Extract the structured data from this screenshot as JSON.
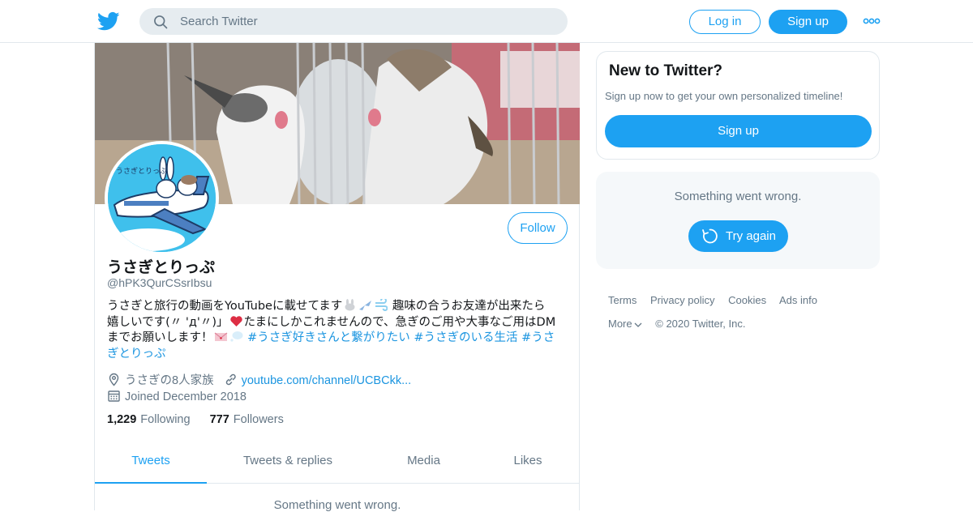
{
  "header": {
    "logo": "twitter-bird-icon",
    "search_placeholder": "Search Twitter",
    "login_label": "Log in",
    "signup_label": "Sign up",
    "more_icon": "more-dots-icon",
    "accent": "#1da1f2"
  },
  "profile": {
    "display_name": "うさぎとりっぷ",
    "handle": "@hPK3QurCSsrIbsu",
    "follow_label": "Follow",
    "bio_line1": "うさぎと旅行の動画をYouTubeに載せてます",
    "bio_line1b": "趣味の合うお友達が出来たら",
    "bio_line2a": "嬉しいです(〃 'д'〃)」",
    "bio_line2b": "たまにしかこれませんので、急ぎのご用や大事なご用はDM",
    "bio_line3": "までお願いします！",
    "bio_tag1": "#うさぎ好きさんと繋がりたい",
    "bio_tag2": "#うさぎのいる生活",
    "bio_tag3": "#うさ",
    "bio_tag3b": "ぎとりっぷ",
    "location": "うさぎの8人家族",
    "url": "youtube.com/channel/UCBCkk...",
    "joined": "Joined December 2018",
    "following_count": "1,229",
    "following_label": "Following",
    "followers_count": "777",
    "followers_label": "Followers",
    "tabs": [
      {
        "label": "Tweets",
        "active": true
      },
      {
        "label": "Tweets & replies",
        "active": false
      },
      {
        "label": "Media",
        "active": false
      },
      {
        "label": "Likes",
        "active": false
      }
    ],
    "timeline_error": "Something went wrong."
  },
  "sidebar": {
    "new_title": "New to Twitter?",
    "new_text": "Sign up now to get your own personalized timeline!",
    "signup_label": "Sign up",
    "error_text": "Something went wrong.",
    "retry_label": "Try again",
    "footer_row1": [
      "Terms",
      "Privacy policy",
      "Cookies",
      "Ads info"
    ],
    "more_label": "More",
    "copyright": "© 2020 Twitter, Inc."
  }
}
